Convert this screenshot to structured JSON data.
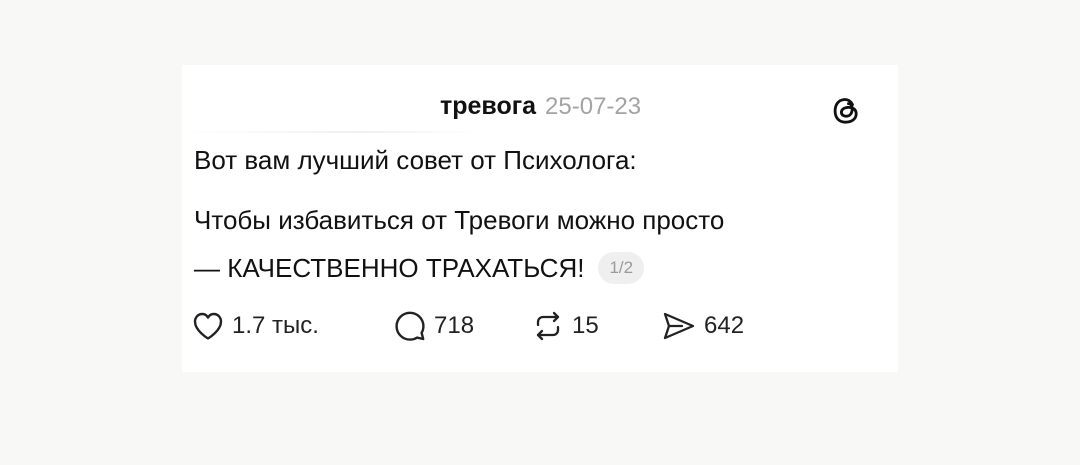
{
  "post": {
    "author": "тревога",
    "date": "25-07-23",
    "text_line1": "Вот вам лучший совет от Психолога:",
    "text_line2": "Чтобы избавиться от Тревоги можно просто",
    "text_line3": "— КАЧЕСТВЕННО ТРАХАТЬСЯ!",
    "page_indicator": "1/2"
  },
  "actions": {
    "likes": "1.7 тыс.",
    "comments": "718",
    "reposts": "15",
    "shares": "642"
  },
  "icons": {
    "like": "heart-icon",
    "comment": "comment-bubble-icon",
    "repost": "repost-icon",
    "share": "send-icon",
    "brand": "threads-logo-icon"
  },
  "colors": {
    "background": "#f8f8f6",
    "card": "#ffffff",
    "text": "#111111",
    "muted": "#a3a3a3",
    "badge_bg": "#efefef"
  }
}
